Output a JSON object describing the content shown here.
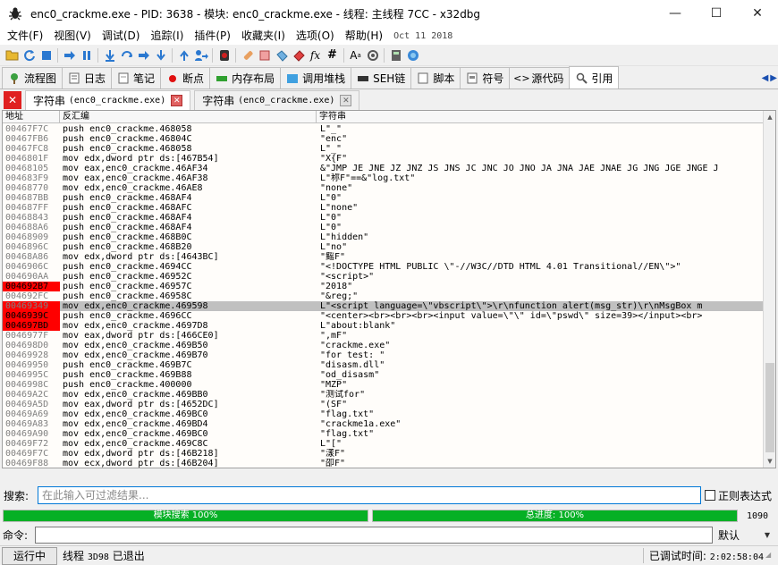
{
  "window": {
    "title": "enc0_crackme.exe - PID: 3638 - 模块: enc0_crackme.exe - 线程: 主线程 7CC - x32dbg",
    "minimize": "—",
    "maximize": "☐",
    "close": "✕"
  },
  "menu": {
    "items": [
      "文件(F)",
      "视图(V)",
      "调试(D)",
      "追踪(I)",
      "插件(P)",
      "收藏夹(I)",
      "选项(O)",
      "帮助(H)"
    ],
    "date": "Oct 11 2018"
  },
  "toolbar": {
    "icons": [
      "open-icon",
      "restart-icon",
      "stop-icon",
      "run-icon",
      "pause-icon",
      "step-into-icon",
      "step-over-icon",
      "trace-into-icon",
      "trace-over-icon",
      "execute-till-return-icon",
      "run-to-user-code-icon",
      "scylla-icon",
      "patch-icon",
      "comment-icon",
      "label-icon",
      "bookmark-icon",
      "function-icon",
      "hash-icon",
      "font-icon",
      "settings-icon",
      "calculator-icon",
      "help-icon"
    ],
    "font_label": "A",
    "fx_label": "fx",
    "hash_label": "#"
  },
  "view_tabs": [
    {
      "label": "流程图",
      "icon": "graph-icon"
    },
    {
      "label": "日志",
      "icon": "log-icon"
    },
    {
      "label": "笔记",
      "icon": "notes-icon"
    },
    {
      "label": "断点",
      "icon": "breakpoint-icon"
    },
    {
      "label": "内存布局",
      "icon": "memory-map-icon"
    },
    {
      "label": "调用堆栈",
      "icon": "call-stack-icon"
    },
    {
      "label": "SEH链",
      "icon": "seh-icon"
    },
    {
      "label": "脚本",
      "icon": "script-icon"
    },
    {
      "label": "符号",
      "icon": "symbols-icon"
    },
    {
      "label": "源代码",
      "icon": "source-icon"
    },
    {
      "label": "引用",
      "icon": "references-icon"
    }
  ],
  "sub_tabs": [
    {
      "title": "字符串",
      "module": "(enc0_crackme.exe)"
    },
    {
      "title": "字符串",
      "module": "(enc0_crackme.exe)"
    }
  ],
  "table": {
    "headers": [
      "地址",
      "反汇编",
      "字符串"
    ],
    "rows": [
      {
        "addr": "00467F7C",
        "dis": "push enc0_crackme.468058",
        "str": "L\"_\"",
        "state": ""
      },
      {
        "addr": "00467FB6",
        "dis": "push enc0_crackme.46804C",
        "str": "\"enc\"",
        "state": ""
      },
      {
        "addr": "00467FC8",
        "dis": "push enc0_crackme.468058",
        "str": "L\"_\"",
        "state": ""
      },
      {
        "addr": "0046801F",
        "dis": "mov edx,dword ptr ds:[467B54]",
        "str": "\"X{F\"",
        "state": ""
      },
      {
        "addr": "00468105",
        "dis": "mov eax,enc0_crackme.46AF34",
        "str": "&\"JMP JE JNE JZ JNZ JS JNS JC JNC JO JNO JA JNA JAE JNAE JG JNG JGE JNGE J",
        "state": ""
      },
      {
        "addr": "004683F9",
        "dis": "mov eax,enc0_crackme.46AF38",
        "str": "L\"称F\"==&\"log.txt\"",
        "state": ""
      },
      {
        "addr": "00468770",
        "dis": "mov edx,enc0_crackme.46AE8",
        "str": "\"none\"",
        "state": ""
      },
      {
        "addr": "004687BB",
        "dis": "push enc0_crackme.468AF4",
        "str": "L\"0\"",
        "state": ""
      },
      {
        "addr": "004687FF",
        "dis": "push enc0_crackme.468AFC",
        "str": "L\"none\"",
        "state": ""
      },
      {
        "addr": "00468843",
        "dis": "push enc0_crackme.468AF4",
        "str": "L\"0\"",
        "state": ""
      },
      {
        "addr": "004688A6",
        "dis": "push enc0_crackme.468AF4",
        "str": "L\"0\"",
        "state": ""
      },
      {
        "addr": "00468909",
        "dis": "push enc0_crackme.468B0C",
        "str": "L\"hidden\"",
        "state": ""
      },
      {
        "addr": "0046896C",
        "dis": "push enc0_crackme.468B20",
        "str": "L\"no\"",
        "state": ""
      },
      {
        "addr": "00468A86",
        "dis": "mov edx,dword ptr ds:[4643BC]",
        "str": "\"鳐F\"",
        "state": ""
      },
      {
        "addr": "0046906C",
        "dis": "push enc0_crackme.4694CC",
        "str": "\"<!DOCTYPE HTML PUBLIC \\\"-//W3C//DTD HTML 4.01 Transitional//EN\\\">\"",
        "state": ""
      },
      {
        "addr": "004690AA",
        "dis": "push enc0_crackme.46952C",
        "str": "\"<script>\"",
        "state": ""
      },
      {
        "addr": "004692B7",
        "dis": "push enc0_crackme.46957C",
        "str": "\"2018\"",
        "state": "bp"
      },
      {
        "addr": "004692FC",
        "dis": "push enc0_crackme.46958C",
        "str": "\"&reg;\"",
        "state": ""
      },
      {
        "addr": "00469349",
        "dis": "mov edx,enc0_crackme.469598",
        "str": "L\"<script language=\\\"vbscript\\\">\\r\\nfunction alert(msg_str)\\r\\nMsgBox m",
        "state": "selected"
      },
      {
        "addr": "0046939C",
        "dis": "push enc0_crackme.4696CC",
        "str": "\"<center><br><br><br><input value=\\\"\\\" id=\\\"pswd\\\" size=39></input><br>",
        "state": "bp"
      },
      {
        "addr": "004697BD",
        "dis": "mov edx,enc0_crackme.4697D8",
        "str": "L\"about:blank\"",
        "state": "bp"
      },
      {
        "addr": "0046977F",
        "dis": "mov eax,dword ptr ds:[466CE0]",
        "str": "\",mF\"",
        "state": ""
      },
      {
        "addr": "004698D0",
        "dis": "mov edx,enc0_crackme.469B50",
        "str": "\"crackme.exe\"",
        "state": ""
      },
      {
        "addr": "00469928",
        "dis": "mov edx,enc0_crackme.469B70",
        "str": "\"for test: \"",
        "state": ""
      },
      {
        "addr": "00469950",
        "dis": "push enc0_crackme.469B7C",
        "str": "\"disasm.dll\"",
        "state": ""
      },
      {
        "addr": "0046995C",
        "dis": "push enc0_crackme.469B88",
        "str": "\"od_disasm\"",
        "state": ""
      },
      {
        "addr": "0046998C",
        "dis": "push enc0_crackme.400000",
        "str": "\"MZP\"",
        "state": ""
      },
      {
        "addr": "00469A2C",
        "dis": "mov edx,enc0_crackme.469BB0",
        "str": "\"测试for\"",
        "state": ""
      },
      {
        "addr": "00469A5D",
        "dis": "mov eax,dword ptr ds:[4652DC]",
        "str": "\"(SF\"",
        "state": ""
      },
      {
        "addr": "00469A69",
        "dis": "mov edx,enc0_crackme.469BC0",
        "str": "\"flag.txt\"",
        "state": ""
      },
      {
        "addr": "00469A83",
        "dis": "mov edx,enc0_crackme.469BD4",
        "str": "\"crackme1a.exe\"",
        "state": ""
      },
      {
        "addr": "00469A90",
        "dis": "mov edx,enc0_crackme.469BC0",
        "str": "\"flag.txt\"",
        "state": ""
      },
      {
        "addr": "00469F72",
        "dis": "mov edx,enc0_crackme.469C8C",
        "str": "L\"[\"",
        "state": ""
      },
      {
        "addr": "00469F7C",
        "dis": "mov edx,dword ptr ds:[46B218]",
        "str": "\"漾F\"",
        "state": ""
      },
      {
        "addr": "00469F88",
        "dis": "mov ecx,dword ptr ds:[46B204]",
        "str": "\"卲F\"",
        "state": ""
      }
    ]
  },
  "search": {
    "label": "搜索:",
    "placeholder": "在此输入可过滤结果...",
    "regex_label": "正则表达式"
  },
  "progress": {
    "module_label": "模块搜索 100%",
    "module_fraction": 1.0,
    "total_label": "总进度: 100%",
    "total_fraction": 1.0,
    "count": "1090"
  },
  "command": {
    "label": "命令:",
    "value": "",
    "mode": "默认"
  },
  "status": {
    "state": "运行中",
    "message_prefix": "线程",
    "thread_id": "3D98",
    "message_suffix": "已退出",
    "time_label": "已调试时间:",
    "time_value": "2:02:58:04"
  },
  "colors": {
    "breakpoint": "#ff0000",
    "selected_row": "#c0c0c0",
    "progress": "#06b025",
    "address_text": "#808080",
    "search_border": "#0078d7"
  }
}
